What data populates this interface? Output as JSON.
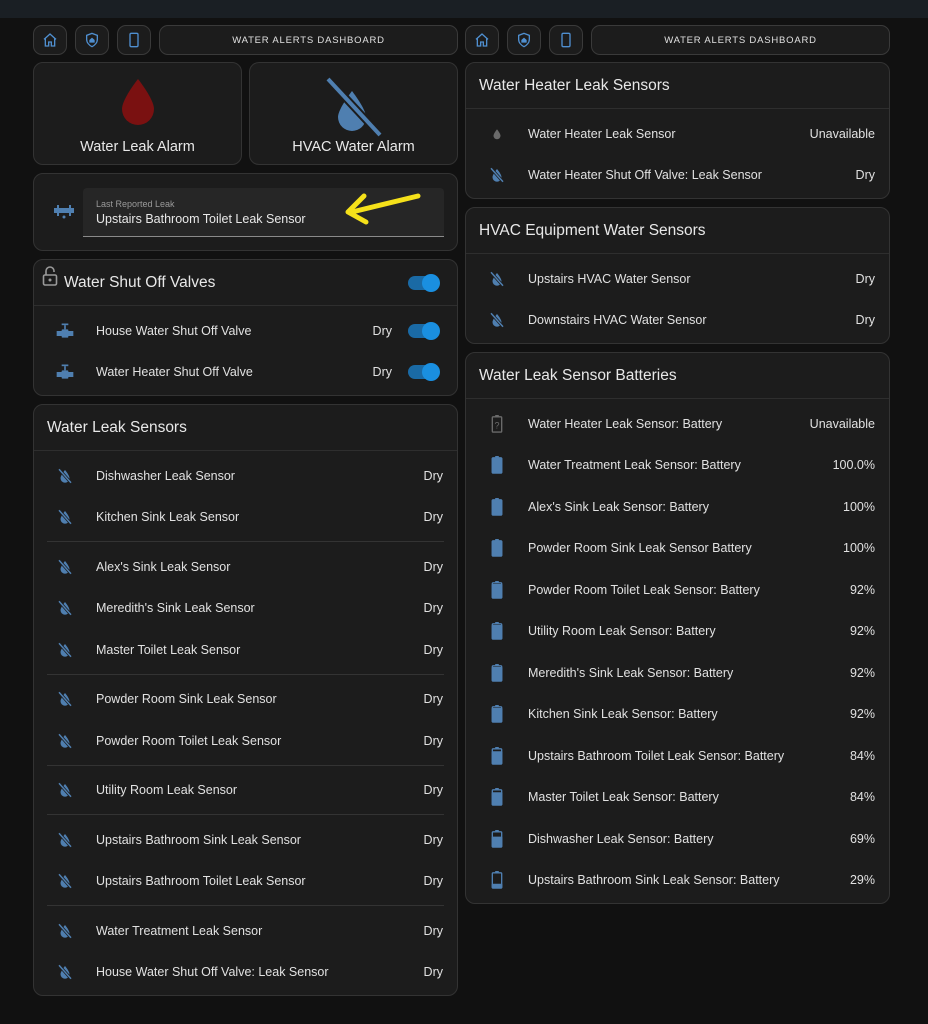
{
  "nav_title": "WATER ALERTS DASHBOARD",
  "nav_icons": [
    "home-icon",
    "shield-home-icon",
    "cellphone-icon"
  ],
  "colors": {
    "accent": "#1a8fe0",
    "icon_blue": "#4f7fb0",
    "alarm_red": "#7a1111",
    "arrow_yellow": "#f5e11a"
  },
  "alarms": {
    "water": "Water Leak Alarm",
    "hvac": "HVAC Water Alarm"
  },
  "last_leak": {
    "label": "Last Reported Leak",
    "value": "Upstairs Bathroom Toilet Leak Sensor"
  },
  "valves": {
    "title": "Water Shut Off Valves",
    "items": [
      {
        "name": "House Water Shut Off Valve",
        "state": "Dry"
      },
      {
        "name": "Water Heater Shut Off Valve",
        "state": "Dry"
      }
    ]
  },
  "leak_sensors": {
    "title": "Water Leak Sensors",
    "items": [
      {
        "name": "Dishwasher Leak Sensor",
        "state": "Dry"
      },
      {
        "name": "Kitchen Sink Leak Sensor",
        "state": "Dry"
      },
      {
        "name": "Alex's Sink Leak Sensor",
        "state": "Dry"
      },
      {
        "name": "Meredith's Sink Leak Sensor",
        "state": "Dry"
      },
      {
        "name": "Master Toilet Leak Sensor",
        "state": "Dry"
      },
      {
        "name": "Powder Room Sink Leak Sensor",
        "state": "Dry"
      },
      {
        "name": "Powder Room Toilet Leak Sensor",
        "state": "Dry"
      },
      {
        "name": "Utility Room Leak Sensor",
        "state": "Dry"
      },
      {
        "name": "Upstairs Bathroom Sink Leak Sensor",
        "state": "Dry"
      },
      {
        "name": "Upstairs Bathroom Toilet Leak Sensor",
        "state": "Dry"
      },
      {
        "name": "Water Treatment Leak Sensor",
        "state": "Dry"
      },
      {
        "name": "House Water Shut Off Valve: Leak Sensor",
        "state": "Dry"
      }
    ]
  },
  "heater": {
    "title": "Water Heater Leak Sensors",
    "items": [
      {
        "name": "Water Heater Leak Sensor",
        "state": "Unavailable"
      },
      {
        "name": "Water Heater Shut Off Valve: Leak Sensor",
        "state": "Dry"
      }
    ]
  },
  "hvac": {
    "title": "HVAC Equipment Water Sensors",
    "items": [
      {
        "name": "Upstairs HVAC Water Sensor",
        "state": "Dry"
      },
      {
        "name": "Downstairs HVAC Water Sensor",
        "state": "Dry"
      }
    ]
  },
  "batteries": {
    "title": "Water Leak Sensor Batteries",
    "items": [
      {
        "name": "Water Heater Leak Sensor: Battery",
        "state": "Unavailable",
        "level": null
      },
      {
        "name": "Water Treatment Leak Sensor: Battery",
        "state": "100.0%",
        "level": 1.0
      },
      {
        "name": "Alex's Sink Leak Sensor: Battery",
        "state": "100%",
        "level": 1.0
      },
      {
        "name": "Powder Room Sink Leak Sensor Battery",
        "state": "100%",
        "level": 1.0
      },
      {
        "name": "Powder Room Toilet Leak Sensor: Battery",
        "state": "92%",
        "level": 0.92
      },
      {
        "name": "Utility Room Leak Sensor: Battery",
        "state": "92%",
        "level": 0.92
      },
      {
        "name": "Meredith's Sink Leak Sensor: Battery",
        "state": "92%",
        "level": 0.92
      },
      {
        "name": "Kitchen Sink Leak Sensor: Battery",
        "state": "92%",
        "level": 0.92
      },
      {
        "name": "Upstairs Bathroom Toilet Leak Sensor: Battery",
        "state": "84%",
        "level": 0.84
      },
      {
        "name": "Master Toilet Leak Sensor: Battery",
        "state": "84%",
        "level": 0.84
      },
      {
        "name": "Dishwasher Leak Sensor: Battery",
        "state": "69%",
        "level": 0.69
      },
      {
        "name": "Upstairs Bathroom Sink Leak Sensor: Battery",
        "state": "29%",
        "level": 0.29
      }
    ]
  }
}
